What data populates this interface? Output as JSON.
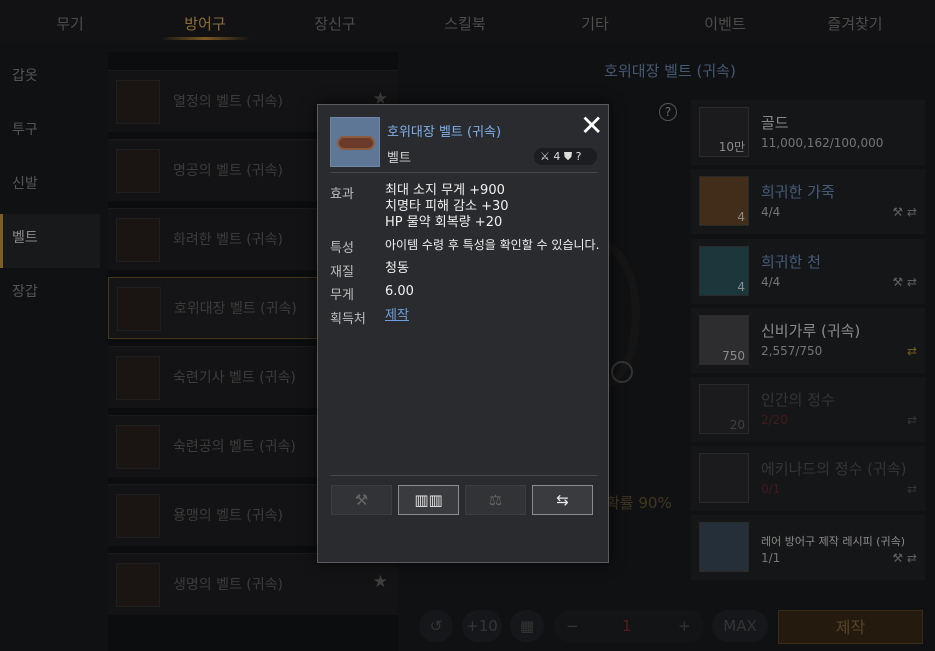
{
  "tabs": [
    {
      "label": "무기"
    },
    {
      "label": "방어구"
    },
    {
      "label": "장신구"
    },
    {
      "label": "스킬북"
    },
    {
      "label": "기타"
    },
    {
      "label": "이벤트"
    },
    {
      "label": "즐겨찾기"
    }
  ],
  "side": [
    {
      "label": "갑옷"
    },
    {
      "label": "투구"
    },
    {
      "label": "신발"
    },
    {
      "label": "벨트"
    },
    {
      "label": "장갑"
    }
  ],
  "list": [
    {
      "name": "열정의 벨트 (귀속)"
    },
    {
      "name": "명공의 벨트 (귀속)"
    },
    {
      "name": "화려한 벨트 (귀속)"
    },
    {
      "name": "호위대장 벨트 (귀속)"
    },
    {
      "name": "숙련기사 벨트 (귀속)"
    },
    {
      "name": "숙련공의 벨트 (귀속)"
    },
    {
      "name": "용맹의 벨트 (귀속)"
    },
    {
      "name": "생명의 벨트 (귀속)"
    }
  ],
  "star_icon": "★",
  "center": {
    "title": "호위대장 벨트 (귀속)",
    "help": "?",
    "rate": "확률 90%"
  },
  "materials": [
    {
      "name": "골드",
      "value": "11,000,162/100,000",
      "count": "10만",
      "acts": ""
    },
    {
      "name": "희귀한 가죽",
      "value": "4/4",
      "count": "4",
      "acts": "⚒ ⇄"
    },
    {
      "name": "희귀한 천",
      "value": "4/4",
      "count": "4",
      "acts": "⚒ ⇄"
    },
    {
      "name": "신비가루 (귀속)",
      "value": "2,557/750",
      "count": "750",
      "acts": "⇄"
    },
    {
      "name": "인간의 정수",
      "value": "2/20",
      "count": "20",
      "acts": "⇄"
    },
    {
      "name": "에키나드의 정수 (귀속)",
      "value": "0/1",
      "count": "",
      "acts": "⇄"
    },
    {
      "name": "레어 방어구 제작 레시피 (귀속)",
      "value": "1/1",
      "count": "",
      "acts": "⚒ ⇄"
    }
  ],
  "controls": {
    "reset": "↺",
    "plus10": "+10",
    "calc": "▦",
    "minus": "−",
    "qty": "1",
    "plus": "+",
    "max": "MAX",
    "craft": "제작"
  },
  "tooltip": {
    "name": "호위대장 벨트 (귀속)",
    "type": "벨트",
    "badge": "4",
    "badge2": "?",
    "close": "✕",
    "effect_label": "효과",
    "effects": [
      "최대 소지 무게 +900",
      "치명타 피해 감소 +30",
      "HP 물약 회복량 +20"
    ],
    "trait_label": "특성",
    "trait": "아이템 수령 후 특성을 확인할 수 있습니다.",
    "material_label": "재질",
    "material": "청동",
    "weight_label": "무게",
    "weight": "6.00",
    "source_label": "획득처",
    "source": "제작"
  }
}
